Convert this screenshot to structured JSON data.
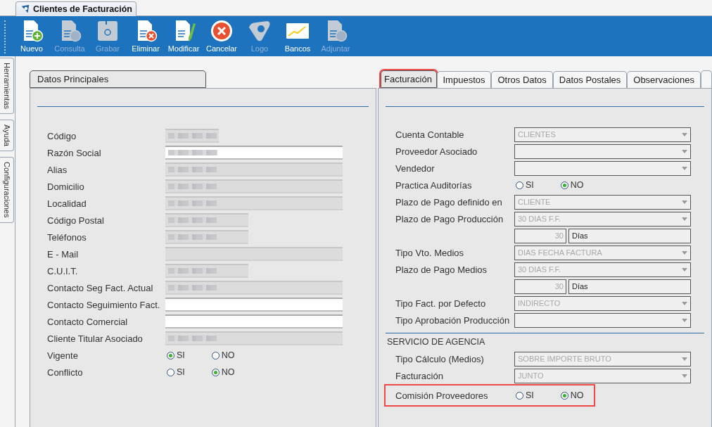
{
  "window": {
    "title": "Clientes de Facturación"
  },
  "toolbar": [
    {
      "label": "Nuevo",
      "disabled": false
    },
    {
      "label": "Consulta",
      "disabled": true
    },
    {
      "label": "Grabar",
      "disabled": true
    },
    {
      "label": "Eliminar",
      "disabled": false
    },
    {
      "label": "Modificar",
      "disabled": false
    },
    {
      "label": "Cancelar",
      "disabled": false
    },
    {
      "label": "Logo",
      "disabled": true
    },
    {
      "label": "Bancos",
      "disabled": false
    },
    {
      "label": "Adjuntar",
      "disabled": true
    }
  ],
  "side_tabs": [
    "Herramientas",
    "Ayuda",
    "Configuraciones"
  ],
  "left_panel": {
    "tab": "Datos Principales",
    "rows": [
      {
        "label": "Código",
        "kind": "tiny_input",
        "redacted": true,
        "editable": false
      },
      {
        "label": "Razón Social",
        "kind": "input",
        "redacted": true,
        "editable": true
      },
      {
        "label": "Alias",
        "kind": "input",
        "redacted": true,
        "editable": false
      },
      {
        "label": "Domicilio",
        "kind": "input",
        "redacted": true,
        "editable": false
      },
      {
        "label": "Localidad",
        "kind": "input",
        "redacted": true,
        "editable": false
      },
      {
        "label": "Código Postal",
        "kind": "short_input",
        "redacted": true,
        "editable": false
      },
      {
        "label": "Teléfonos",
        "kind": "short_input",
        "redacted": true,
        "editable": false
      },
      {
        "label": "E - Mail",
        "kind": "input",
        "redacted": false,
        "editable": false
      },
      {
        "label": "C.U.I.T.",
        "kind": "short_input",
        "redacted": true,
        "editable": false
      },
      {
        "label": "Contacto Seg Fact. Actual",
        "kind": "input",
        "redacted": true,
        "editable": false
      },
      {
        "label": "Contacto Seguimiento Fact.",
        "kind": "input",
        "redacted": false,
        "editable": true
      },
      {
        "label": "Contacto Comercial",
        "kind": "input",
        "redacted": false,
        "editable": true
      },
      {
        "label": "Cliente Titular Asociado",
        "kind": "input",
        "redacted": true,
        "editable": false
      },
      {
        "label": "Vigente",
        "kind": "radio",
        "options": [
          {
            "label": "SI",
            "selected": true
          },
          {
            "label": "NO",
            "selected": false
          }
        ]
      },
      {
        "label": "Conflicto",
        "kind": "radio",
        "options": [
          {
            "label": "SI",
            "selected": false
          },
          {
            "label": "NO",
            "selected": true
          }
        ]
      }
    ]
  },
  "right_panel": {
    "tabs": [
      {
        "label": "Facturación",
        "selected": true,
        "highlighted": true
      },
      {
        "label": "Impuestos",
        "selected": false,
        "highlighted": false
      },
      {
        "label": "Otros Datos",
        "selected": false,
        "highlighted": false
      },
      {
        "label": "Datos Postales",
        "selected": false,
        "highlighted": false
      },
      {
        "label": "Observaciones",
        "selected": false,
        "highlighted": false
      }
    ],
    "rows": [
      {
        "label": "Cuenta Contable",
        "kind": "select",
        "value": "CLIENTES"
      },
      {
        "label": "Proveedor Asociado",
        "kind": "select"
      },
      {
        "label": "Vendedor",
        "kind": "select"
      },
      {
        "label": "Practica Auditorías",
        "kind": "radio",
        "options": [
          {
            "label": "SI",
            "selected": false
          },
          {
            "label": "NO",
            "selected": true
          }
        ]
      },
      {
        "label": "Plazo de Pago definido en",
        "kind": "select",
        "value": "CLIENTE"
      },
      {
        "label": "Plazo de Pago Producción",
        "kind": "select",
        "value": "30 DIAS F.F."
      },
      {
        "kind": "days",
        "value": "30",
        "unit": "Días"
      },
      {
        "label": "Tipo Vto. Medios",
        "kind": "select",
        "value": "DIAS FECHA FACTURA"
      },
      {
        "label": "Plazo de Pago Medios",
        "kind": "select",
        "value": "30 DIAS F.F."
      },
      {
        "kind": "days",
        "value": "30",
        "unit": "Días"
      },
      {
        "label": "Tipo Fact. por Defecto",
        "kind": "select",
        "value": "INDIRECTO"
      },
      {
        "label": "Tipo Aprobación Producción",
        "kind": "select"
      },
      {
        "label": "SERVICIO DE AGENCIA",
        "kind": "section"
      },
      {
        "label": "Tipo Cálculo (Medios)",
        "kind": "select",
        "value": "SOBRE IMPORTE BRUTO"
      },
      {
        "label": "Facturación",
        "kind": "select",
        "value": "JUNTO"
      },
      {
        "label": "Comisión Proveedores",
        "kind": "radio",
        "highlighted": true,
        "options": [
          {
            "label": "SI",
            "selected": false
          },
          {
            "label": "NO",
            "selected": true
          }
        ]
      }
    ]
  }
}
